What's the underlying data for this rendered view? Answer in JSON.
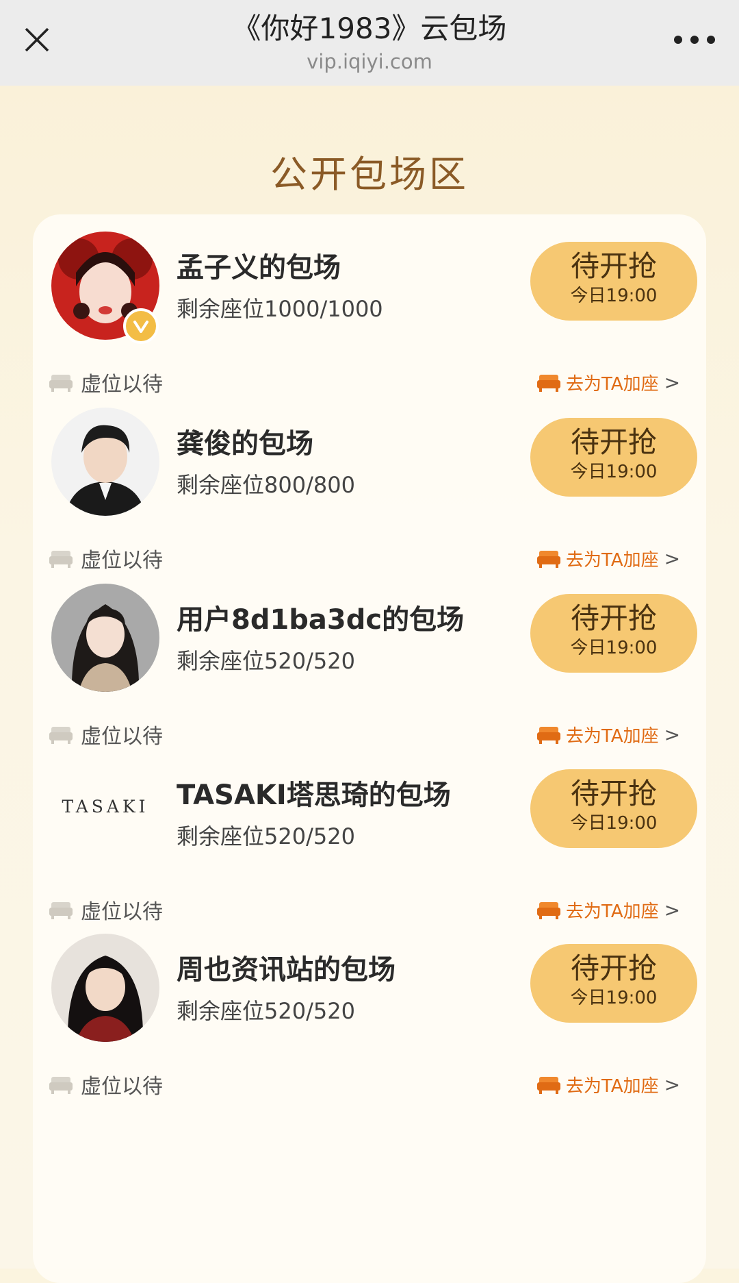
{
  "header": {
    "title": "《你好1983》云包场",
    "url": "vip.iqiyi.com",
    "close_icon": "close-icon",
    "more_icon": "more-dots-icon"
  },
  "section": {
    "title": "公开包场区"
  },
  "colors": {
    "accent": "#e06b14",
    "button_bg": "#f6c872",
    "section_title": "#8a5a26",
    "page_bg": "#fbf4df"
  },
  "screenings": [
    {
      "host": "孟子义的包场",
      "seats": "剩余座位1000/1000",
      "status": "待开抢",
      "time": "今日19:00",
      "seat_label": "虚位以待",
      "add_label": "去为TA加座",
      "avatar_icon": "woman-red-dress-avatar",
      "verified": true
    },
    {
      "host": "龚俊的包场",
      "seats": "剩余座位800/800",
      "status": "待开抢",
      "time": "今日19:00",
      "seat_label": "虚位以待",
      "add_label": "去为TA加座",
      "avatar_icon": "man-suit-avatar"
    },
    {
      "host": "用户8d1ba3dc的包场",
      "seats": "剩余座位520/520",
      "status": "待开抢",
      "time": "今日19:00",
      "seat_label": "虚位以待",
      "add_label": "去为TA加座",
      "avatar_icon": "woman-long-hair-avatar"
    },
    {
      "host": "TASAKI塔思琦的包场",
      "seats": "剩余座位520/520",
      "status": "待开抢",
      "time": "今日19:00",
      "seat_label": "虚位以待",
      "add_label": "去为TA加座",
      "avatar_logo": "TASAKI"
    },
    {
      "host": "周也资讯站的包场",
      "seats": "剩余座位520/520",
      "status": "待开抢",
      "time": "今日19:00",
      "seat_label": "虚位以待",
      "add_label": "去为TA加座",
      "avatar_icon": "woman-dark-hair-avatar"
    }
  ]
}
